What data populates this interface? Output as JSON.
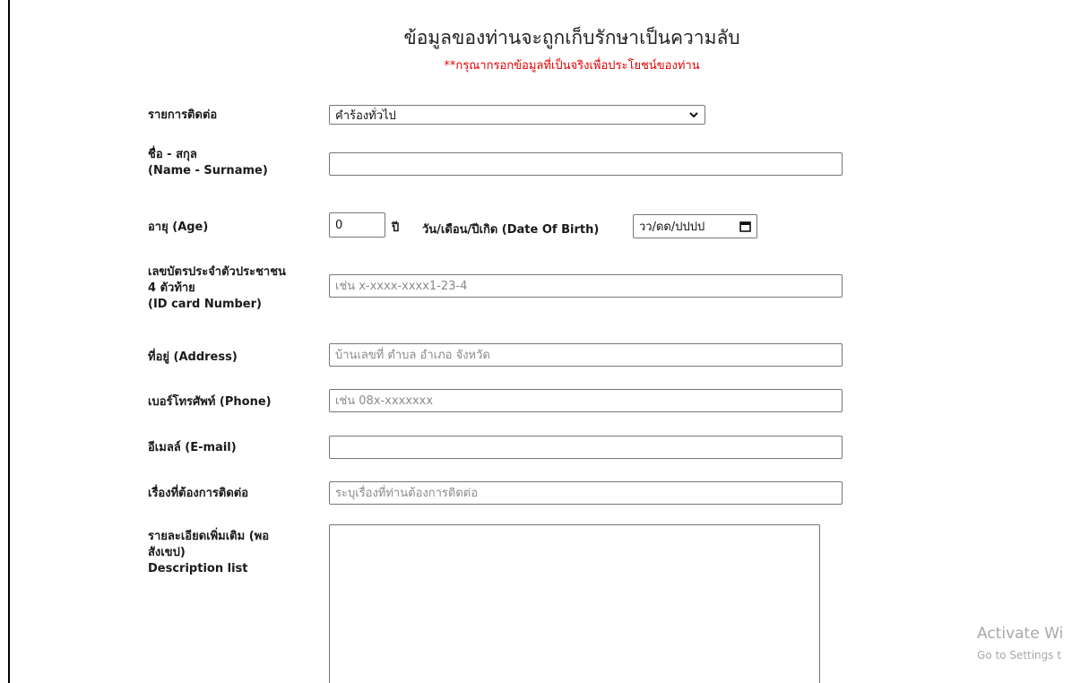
{
  "header": {
    "title": "ข้อมูลของท่านจะถูกเก็บรักษาเป็นความลับ",
    "subtitle": "**กรุณากรอกข้อมูลที่เป็นจริงเพื่อประโยชน์ของท่าน"
  },
  "form": {
    "contact_type": {
      "label": "รายการติดต่อ",
      "selected": "คำร้องทั่วไป"
    },
    "name": {
      "label_line1": "ชื่อ - สกุล",
      "label_line2": "(Name - Surname)",
      "value": "",
      "placeholder": ""
    },
    "age": {
      "label": "อายุ (Age)",
      "value": "0",
      "unit": "ปี"
    },
    "dob": {
      "label": "วัน/เดือน/ปีเกิด (Date Of Birth)",
      "value": "วว/ดด/ปปปป"
    },
    "id_card": {
      "label_line1": "เลขบัตรประจำตัวประชาชน",
      "label_line2": "4 ตัวท้าย",
      "label_line3": "(ID card Number)",
      "placeholder": "เช่น x-xxxx-xxxx1-23-4"
    },
    "address": {
      "label": "ที่อยู่ (Address)",
      "placeholder": "บ้านเลขที่ ตำบล อำเภอ จังหวัด"
    },
    "phone": {
      "label": "เบอร์โทรศัพท์ (Phone)",
      "placeholder": "เช่น 08x-xxxxxxx"
    },
    "email": {
      "label": "อีเมลล์ (E-mail)",
      "placeholder": ""
    },
    "subject": {
      "label": "เรื่องที่ต้องการติดต่อ",
      "placeholder": "ระบุเรื่องที่ท่านต้องการติดต่อ"
    },
    "description": {
      "label_line1": "รายละเอียดเพิ่มเติม (พอ",
      "label_line2": "สังเขป)",
      "label_line3": "Description list"
    }
  },
  "watermark": {
    "line1": "Activate Wi",
    "line2": "Go to Settings t"
  },
  "colors": {
    "subtitle": "#e60000",
    "border": "#767676"
  }
}
